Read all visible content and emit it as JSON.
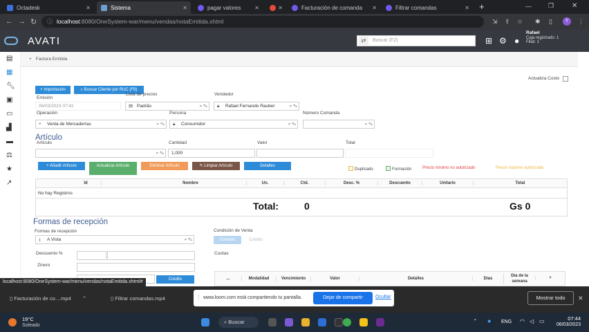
{
  "browser": {
    "tabs": [
      {
        "label": "Octadesk",
        "color": "#3b6fd9"
      },
      {
        "label": "Sistema",
        "color": "#6aa0d0"
      },
      {
        "label": "pagar valores",
        "color": "#6b5cf0"
      },
      {
        "label": "",
        "color": "#e64a3b"
      },
      {
        "label": "Facturación de comanda",
        "color": "#6b5cf0"
      },
      {
        "label": "Filtrar comandas",
        "color": "#6b5cf0"
      }
    ],
    "new_tab": "+",
    "address_host": "localhost",
    "address_path": ":8080/OneSystem-war/menu/vendas/notaEmitida.xhtml"
  },
  "app": {
    "brand": "AVATI",
    "search_placeholder": "Buscar (F2)",
    "user_name": "Rafael",
    "user_line2": "Caja registrado: 1",
    "user_line3": "Filial: 1"
  },
  "breadcrumb": "Factura Emitida",
  "actualiza_costo": "Actualiza Costo",
  "toolbar": {
    "importacion": "Importación",
    "buscar_ruc": "Buscar Cliente por RUC (F9)"
  },
  "form": {
    "emision_label": "Emisión",
    "emision_value": "06/03/2023 07:42",
    "lista_label": "Lista de precios",
    "lista_value": "Padrão",
    "vendedor_label": "Vendedor",
    "vendedor_value": "Rafael Fernando Rauber",
    "operacion_label": "Operación",
    "operacion_value": "Venta de Mercaderías",
    "persona_label": "Persona",
    "persona_value": "Consumidor",
    "numero_label": "Número Comanda",
    "numero_value": ""
  },
  "articulo": {
    "title": "Artículo",
    "articulo_label": "Artículo",
    "cantidad_label": "Cantidad",
    "cantidad_value": "1,000",
    "valor_label": "Valor",
    "total_label": "Total",
    "btn_add": "Añadir Artículo",
    "btn_update": "Actualizar Artículo",
    "btn_remove": "Eliminar Artículo",
    "btn_clear": "Limpiar Artículo",
    "btn_details": "Detalles"
  },
  "legend": {
    "duplicado": "Duplicado",
    "formacion": "Formación",
    "precio_min": "Precio mínimo no autorizado",
    "precio_max": "Precio máximo autorizado"
  },
  "table": {
    "headers": [
      "Id",
      "Nombre",
      "Un.",
      "Ctd.",
      "Desc. %",
      "Descuento",
      "Unitario",
      "Total"
    ],
    "empty": "No hay Registros",
    "total_label": "Total:",
    "total_qty": "0",
    "total_value": "Gs 0"
  },
  "recepcion": {
    "title": "Formas de recepción",
    "formas_label": "Formas de recepción",
    "formas_value": "A Vista",
    "descuento_label": "Descuento %",
    "zinero_label": "Zinero",
    "credito_btn": "Crédito",
    "condicion_label": "Condición de Venta",
    "contado": "Contado",
    "credito": "Crédito",
    "cuotas_label": "Cuotas",
    "cuotas_headers": [
      "...",
      "Modalidad",
      "Vencimiento",
      "Valor",
      "Detalles",
      "Días",
      "Día de la semana",
      "+"
    ]
  },
  "status_url": "localhost:8080/OneSystem-war/menu/vendas/notaEmitida.xhtml#",
  "downloads": [
    {
      "label": "Facturación de co....mp4"
    },
    {
      "label": "Filtrar comandas.mp4"
    }
  ],
  "loom": {
    "message": "www.loom.com está compartiendo tu pantalla.",
    "stop": "Dejar de compartir",
    "hide": "Ocultar"
  },
  "show_all": "Mostrar todo",
  "taskbar": {
    "weather_temp": "19°C",
    "weather_desc": "Soleado",
    "search": "Buscar",
    "lang": "ENG",
    "time": "07:44",
    "date": "06/03/2023"
  }
}
